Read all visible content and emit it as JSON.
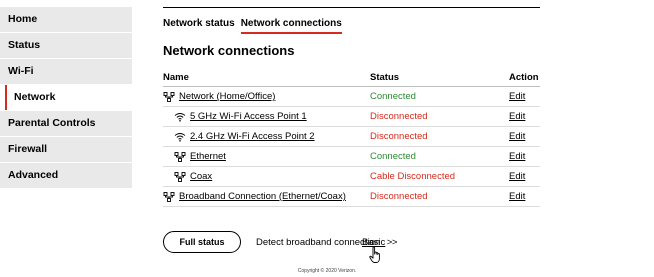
{
  "sidebar": {
    "items": [
      {
        "label": "Home"
      },
      {
        "label": "Status"
      },
      {
        "label": "Wi-Fi"
      },
      {
        "label": "Network"
      },
      {
        "label": "Parental Controls"
      },
      {
        "label": "Firewall"
      },
      {
        "label": "Advanced"
      }
    ],
    "active_item": "Network"
  },
  "tabs": [
    {
      "label": "Network status"
    },
    {
      "label": "Network connections"
    }
  ],
  "active_tab": "Network connections",
  "page_title": "Network connections",
  "table": {
    "headers": {
      "name": "Name",
      "status": "Status",
      "action": "Action"
    },
    "rows": [
      {
        "name": "Network (Home/Office)",
        "status": "Connected",
        "action": "Edit",
        "icon": "network-icon"
      },
      {
        "name": "5 GHz Wi-Fi Access Point 1",
        "status": "Disconnected",
        "action": "Edit",
        "icon": "wifi-icon"
      },
      {
        "name": "2.4 GHz Wi-Fi Access Point 2",
        "status": "Disconnected",
        "action": "Edit",
        "icon": "wifi-icon"
      },
      {
        "name": "Ethernet",
        "status": "Connected",
        "action": "Edit",
        "icon": "network-icon"
      },
      {
        "name": "Coax",
        "status": "Cable Disconnected",
        "action": "Edit",
        "icon": "network-icon"
      },
      {
        "name": "Broadband Connection (Ethernet/Coax)",
        "status": "Disconnected",
        "action": "Edit",
        "icon": "network-icon"
      }
    ]
  },
  "actions": {
    "full_status": "Full status",
    "detect": "Detect broadband connection",
    "basic": "Basic",
    "chevron": ">"
  },
  "colors": {
    "accent": "#d52b1e",
    "connected": "#2d8a34",
    "disconnected": "#d52b1e",
    "sidebar_bg": "#e9e9e9"
  },
  "footer": {
    "copyright": "Copyright © 2020 Verizon."
  }
}
